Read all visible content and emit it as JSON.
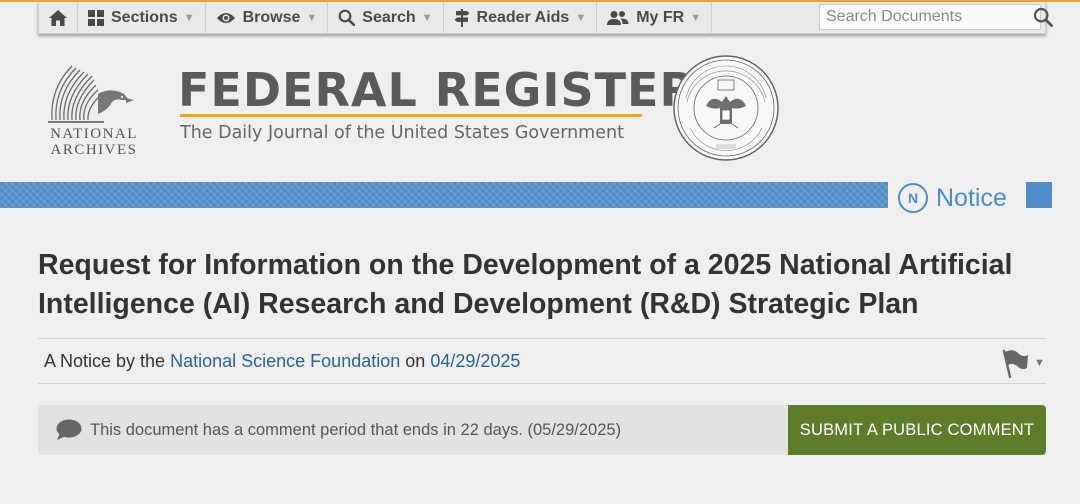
{
  "nav": {
    "items": [
      {
        "label": "Sections",
        "icon": "grid-icon"
      },
      {
        "label": "Browse",
        "icon": "eye-icon"
      },
      {
        "label": "Search",
        "icon": "search-icon"
      },
      {
        "label": "Reader Aids",
        "icon": "signpost-icon"
      },
      {
        "label": "My FR",
        "icon": "users-icon"
      }
    ],
    "caret": "▼",
    "search_placeholder": "Search Documents"
  },
  "header": {
    "archives_line1": "NATIONAL",
    "archives_line2": "ARCHIVES",
    "title": "FEDERAL REGISTER",
    "subtitle": "The Daily Journal of the United States Government"
  },
  "document": {
    "type_badge": "N",
    "type_label": "Notice",
    "title": "Request for Information on the Development of a 2025 National Artificial Intelligence (AI) Research and Development (R&D) Strategic Plan",
    "byline_prefix": "A Notice by the",
    "agency": "National Science Foundation",
    "byline_on": "on",
    "date": "04/29/2025"
  },
  "comment": {
    "text": "This document has a comment period that ends in 22 days. (05/29/2025)",
    "button_label": "SUBMIT A PUBLIC COMMENT"
  },
  "colors": {
    "accent_orange": "#e8a33d",
    "notice_blue": "#4d8ec9",
    "link_blue": "#2a6496",
    "button_green": "#5e7d2a"
  }
}
